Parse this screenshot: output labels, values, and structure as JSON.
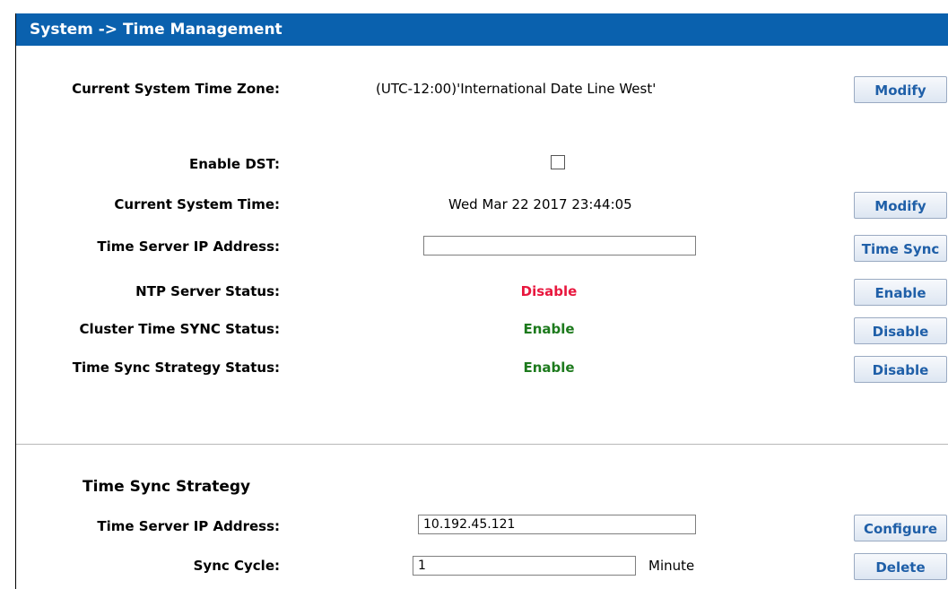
{
  "header": {
    "title": "System -> Time Management"
  },
  "rows": {
    "timezone": {
      "label": "Current System Time Zone:",
      "value": "(UTC-12:00)'International Date Line West'",
      "button": "Modify"
    },
    "dst": {
      "label": "Enable DST:",
      "checked": false
    },
    "system_time": {
      "label": "Current System Time:",
      "value": "Wed Mar 22 2017 23:44:05",
      "button": "Modify"
    },
    "time_server": {
      "label": "Time Server IP Address:",
      "value": "",
      "button": "Time Sync"
    },
    "ntp_status": {
      "label": "NTP Server Status:",
      "value": "Disable",
      "button": "Enable",
      "color": "#e8173e"
    },
    "cluster_sync": {
      "label": "Cluster Time SYNC Status:",
      "value": "Enable",
      "button": "Disable",
      "color": "#1d7a1d"
    },
    "strategy_status": {
      "label": "Time Sync Strategy Status:",
      "value": "Enable",
      "button": "Disable",
      "color": "#1d7a1d"
    }
  },
  "strategy": {
    "title": "Time Sync Strategy",
    "server": {
      "label": "Time Server IP Address:",
      "value": "10.192.45.121",
      "button": "Configure"
    },
    "cycle": {
      "label": "Sync Cycle:",
      "value": "1",
      "unit": "Minute",
      "button": "Delete"
    }
  },
  "colors": {
    "header_bg": "#0a61ae",
    "button_text": "#1f5fa8",
    "disabled_red": "#e8173e",
    "enabled_green": "#1d7a1d"
  }
}
